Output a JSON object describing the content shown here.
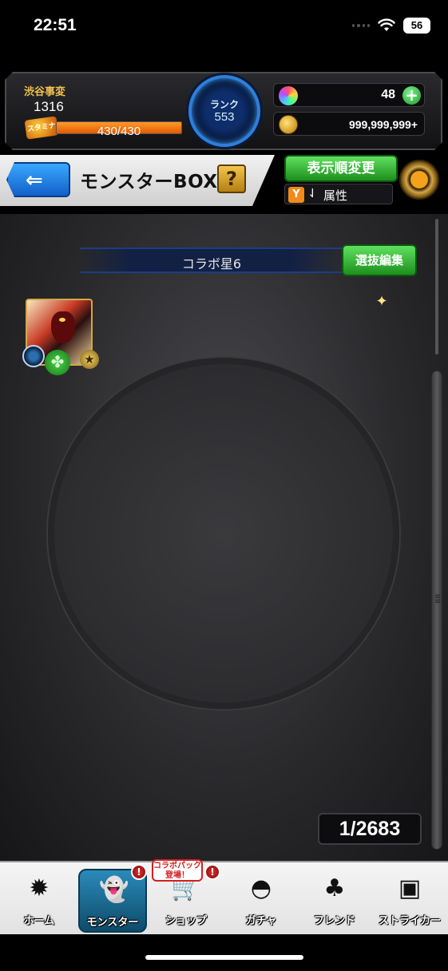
{
  "status_bar": {
    "time": "22:51",
    "battery": "56"
  },
  "player": {
    "name": "渋谷事変",
    "id": "1316",
    "stamina_badge": "スタミナ",
    "stamina": "430/430",
    "stamina_fraction": 1.0
  },
  "rank": {
    "label": "ランク",
    "value": "553"
  },
  "resources": {
    "gems": "48",
    "gold": "999,999,999+"
  },
  "title_bar": {
    "back_icon": "back-arrow-icon",
    "title": "モンスターBOX",
    "help": "?",
    "sort_button": "表示順変更",
    "filter_label": "属性"
  },
  "box": {
    "section_title": "コラボ星6",
    "select_edit_button": "選抜編集",
    "counter": "1/2683"
  },
  "nav": {
    "items": [
      {
        "label": "ホーム",
        "icon": "home-icon"
      },
      {
        "label": "モンスター",
        "icon": "monster-icon"
      },
      {
        "label": "ショップ",
        "icon": "cart-icon"
      },
      {
        "label": "ガチャ",
        "icon": "gacha-icon"
      },
      {
        "label": "フレンド",
        "icon": "friends-icon"
      },
      {
        "label": "ストライカー",
        "icon": "striker-card-icon"
      }
    ],
    "collab_bubble": "コラボパック\n登場！"
  },
  "colors": {
    "accent_green": "#1d8f1d",
    "accent_blue": "#2f7fdc",
    "stamina_orange": "#e25a00"
  }
}
